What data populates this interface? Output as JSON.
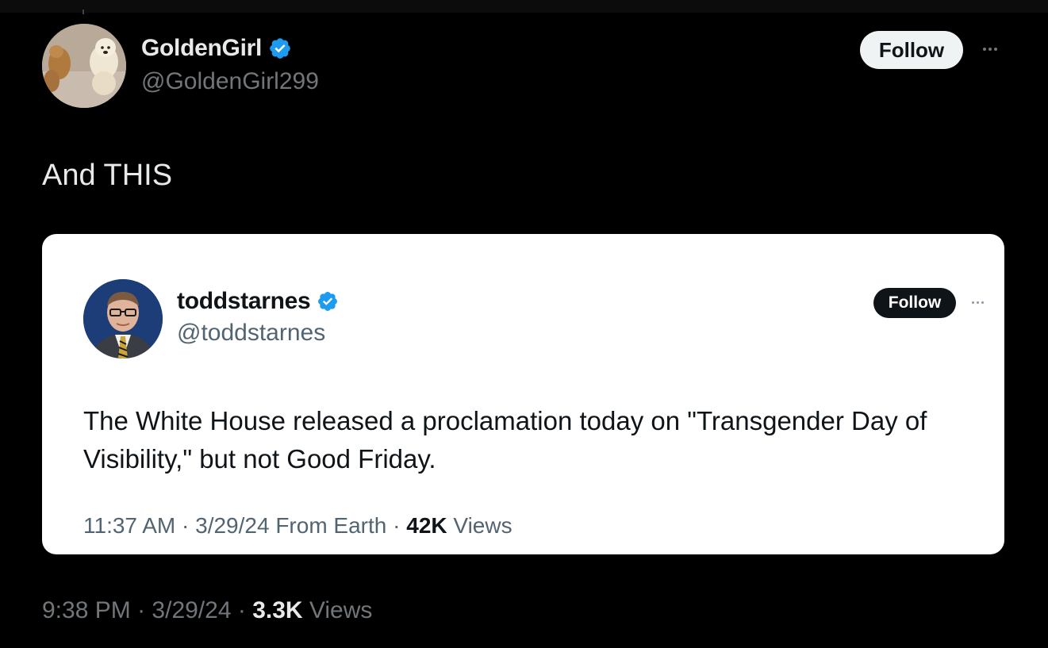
{
  "outer_tweet": {
    "display_name": "GoldenGirl",
    "handle": "@GoldenGirl299",
    "follow_label": "Follow",
    "text": "And THIS",
    "time": "9:38 PM",
    "date": "3/29/24",
    "separator": "·",
    "views_count": "3.3K",
    "views_label": "Views"
  },
  "quoted_tweet": {
    "display_name": "toddstarnes",
    "handle": "@toddstarnes",
    "follow_label": "Follow",
    "text": "The White House released a proclamation today on \"Transgender Day of Visibility,\" but not Good Friday.",
    "time": "11:37 AM",
    "date": "3/29/24",
    "source": "From Earth",
    "separator": "·",
    "views_count": "42K",
    "views_label": "Views"
  },
  "colors": {
    "background": "#000000",
    "card_background": "#ffffff",
    "verified_badge": "#1d9bf0",
    "secondary_text_dark": "#71767b",
    "secondary_text_light": "#536471"
  },
  "icons": {
    "verified": "verified-badge-icon",
    "more": "more-options-icon"
  }
}
